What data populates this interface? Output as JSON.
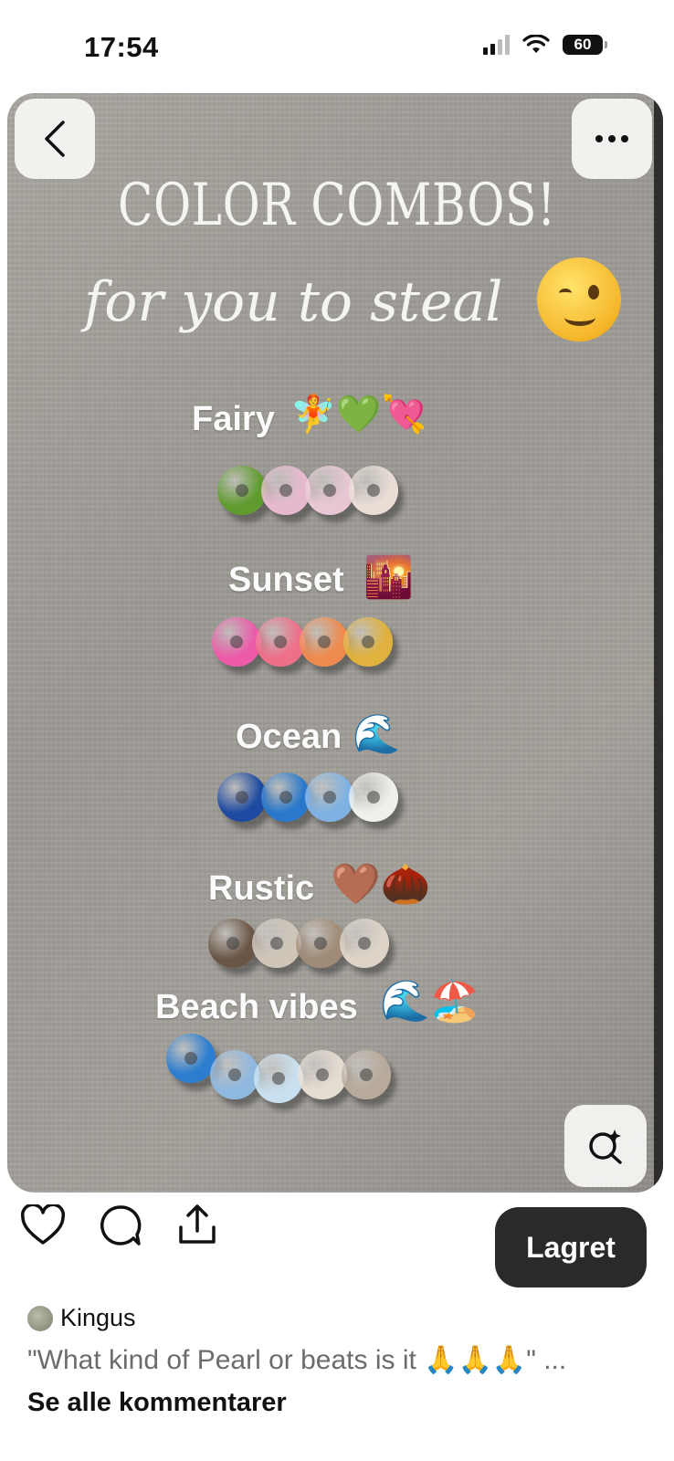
{
  "status_bar": {
    "time": "17:54",
    "battery": "60"
  },
  "pin": {
    "title": "COLOR COMBOS!",
    "subtitle": "for you to steal",
    "combos": [
      {
        "label": "Fairy",
        "emojis": "🧚💚💘",
        "beads": [
          "#5f9b2e",
          "#e7b9cf",
          "#e8c7d4",
          "#e9ddd5"
        ]
      },
      {
        "label": "Sunset",
        "emojis": "🌇",
        "beads": [
          "#ec5aa8",
          "#ee6f89",
          "#ee8a4e",
          "#e0b13c"
        ]
      },
      {
        "label": "Ocean",
        "emojis": "🌊",
        "beads": [
          "#1e4aa1",
          "#2a78cb",
          "#7fb2e2",
          "#eef0ea"
        ]
      },
      {
        "label": "Rustic",
        "emojis": "🤎🌰",
        "beads": [
          "#6a5646",
          "#cfc6b8",
          "#a08b76",
          "#ddd3c7"
        ]
      },
      {
        "label": "Beach vibes",
        "emojis": "🌊🏖️",
        "beads": [
          "#2b7dcf",
          "#8fb8e0",
          "#c8e0ef",
          "#e6ddd2",
          "#b8aa9a"
        ]
      }
    ]
  },
  "icons": {
    "back": "chevron-left-icon",
    "more": "more-horizontal-icon",
    "lens": "visual-search-icon",
    "like": "heart-icon",
    "comment": "comment-icon",
    "share": "share-icon"
  },
  "actions": {
    "save_label": "Lagret"
  },
  "comment_section": {
    "author": "Kingus",
    "comment": "\"What kind of Pearl or beats is it 🙏🙏🙏\" ...",
    "see_all": "Se alle kommentarer"
  }
}
